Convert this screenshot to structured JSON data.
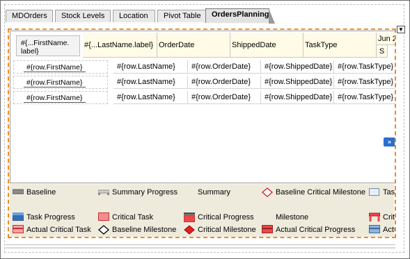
{
  "tabs": [
    {
      "label": "MDOrders"
    },
    {
      "label": "Stock Levels"
    },
    {
      "label": "Location"
    },
    {
      "label": "Pivot Table"
    },
    {
      "label": "OrdersPlanning"
    }
  ],
  "dropdown_icon": "chevron-down-icon",
  "gantt": {
    "headers": {
      "first_name": "#{...FirstName.\nlabel}",
      "last_name": "#{...LastName.label}",
      "order_date": "OrderDate",
      "shipped_date": "ShippedDate",
      "task_type": "TaskType",
      "timeline_month": "Jun 2",
      "timeline_day": "S"
    },
    "rows": [
      {
        "first_name": "#{row.FirstName}",
        "last_name": "#{row.LastName}",
        "order_date": "#{row.OrderDate}",
        "shipped_date": "#{row.ShippedDate}",
        "task_type": "#{row.TaskType}"
      },
      {
        "first_name": "#{row.FirstName}",
        "last_name": "#{row.LastName}",
        "order_date": "#{row.OrderDate}",
        "shipped_date": "#{row.ShippedDate}",
        "task_type": "#{row.TaskType}"
      },
      {
        "first_name": "#{row.FirstName}",
        "last_name": "#{row.LastName}",
        "order_date": "#{row.OrderDate}",
        "shipped_date": "#{row.ShippedDate}",
        "task_type": "#{row.TaskType}"
      }
    ],
    "scroll_indicator": "»"
  },
  "legend": {
    "baseline": "Baseline",
    "summary_progress": "Summary Progress",
    "summary": "Summary",
    "baseline_critical_milestone": "Baseline Critical Milestone",
    "task_cut": "Tas",
    "task_progress": "Task Progress",
    "critical_task": "Critical Task",
    "critical_progress": "Critical Progress",
    "milestone": "Milestone",
    "critical_cut": "Criti",
    "actual_critical_task": "Actual Critical Task",
    "baseline_milestone": "Baseline Milestone",
    "critical_milestone": "Critical Milestone",
    "actual_critical_progress": "Actual Critical Progress",
    "actual_cut": "Actu"
  },
  "colors": {
    "panel_border": "#f08a24",
    "legend_bg": "#eeebdd",
    "header_bg": "#fffbe6",
    "critical_red": "#e84a4a",
    "task_blue": "#2f6fb8"
  }
}
